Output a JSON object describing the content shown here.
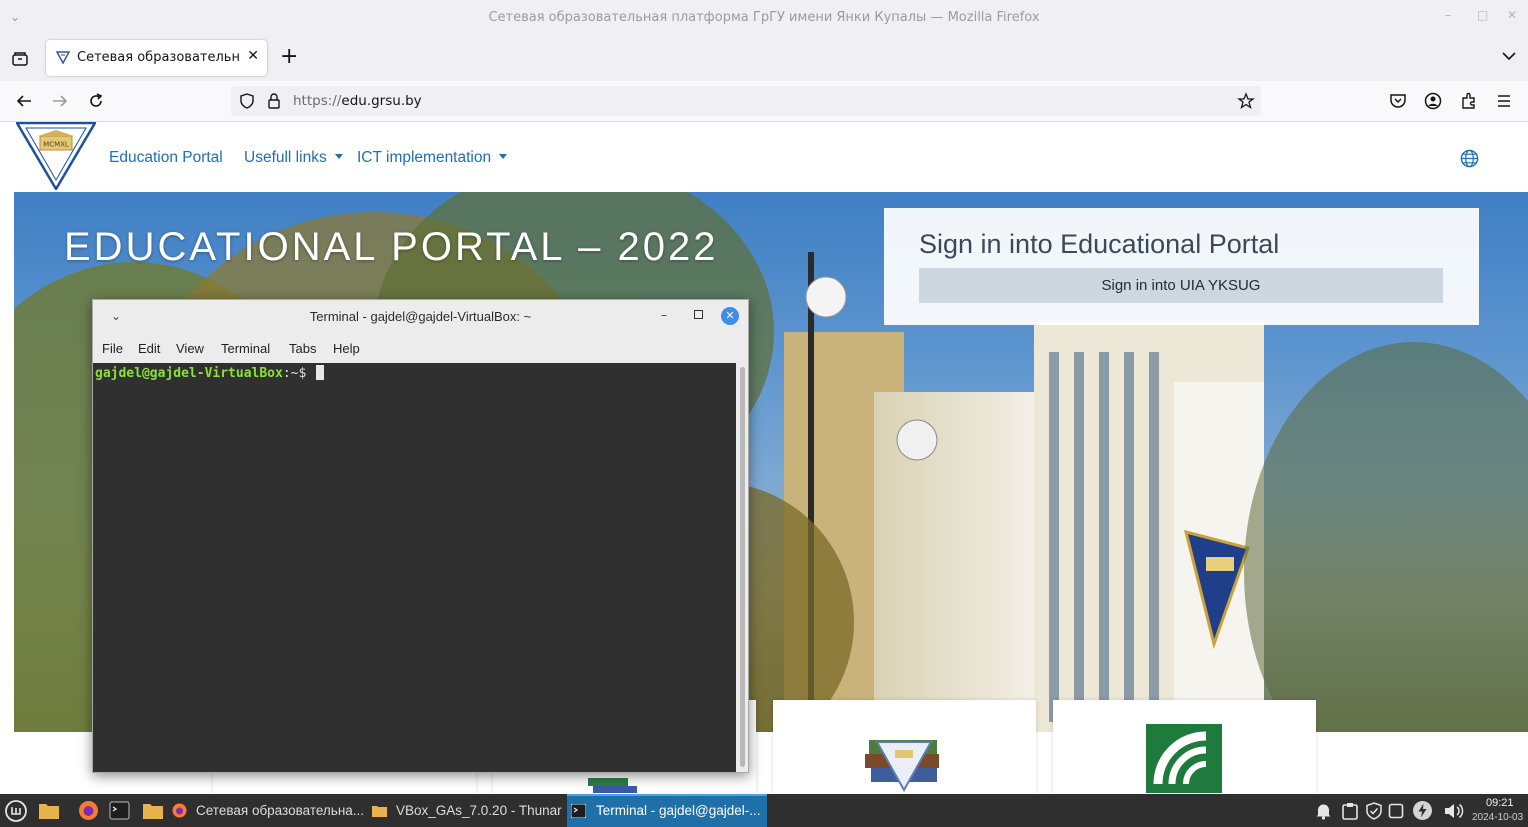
{
  "browser": {
    "window_title": "Сетевая образовательная платформа ГрГУ имени Янки Купалы — Mozilla Firefox",
    "tab_title": "Сетевая образовательная платформа ГрГУ",
    "url_protocol": "https://",
    "url_host": "edu.grsu.by",
    "new_tab_label": "+"
  },
  "site": {
    "logo_text": "MCMXL",
    "nav": {
      "education_portal": "Education Portal",
      "usefull_links": "Usefull links",
      "ict_implementation": "ICT implementation"
    },
    "hero_title": "EDUCATIONAL PORTAL – 2022",
    "signin": {
      "title": "Sign in into Educational Portal",
      "button": "Sign in into UIA YKSUG"
    }
  },
  "terminal": {
    "title": "Terminal - gajdel@gajdel-VirtualBox: ~",
    "menu": [
      "File",
      "Edit",
      "View",
      "Terminal",
      "Tabs",
      "Help"
    ],
    "prompt_user": "gajdel@gajdel-VirtualBox",
    "prompt_path": ":~$"
  },
  "taskbar": {
    "items": [
      "Сетевая образовательна...",
      "VBox_GAs_7.0.20 - Thunar",
      "Terminal - gajdel@gajdel-..."
    ],
    "time": "09:21",
    "date": "2024-10-03"
  },
  "colors": {
    "link": "#1e6fb5",
    "terminal_bg": "#303030",
    "prompt_green": "#8ae234",
    "taskbar_bg": "#2f2f2f",
    "taskbar_active": "#1f6fa8"
  }
}
